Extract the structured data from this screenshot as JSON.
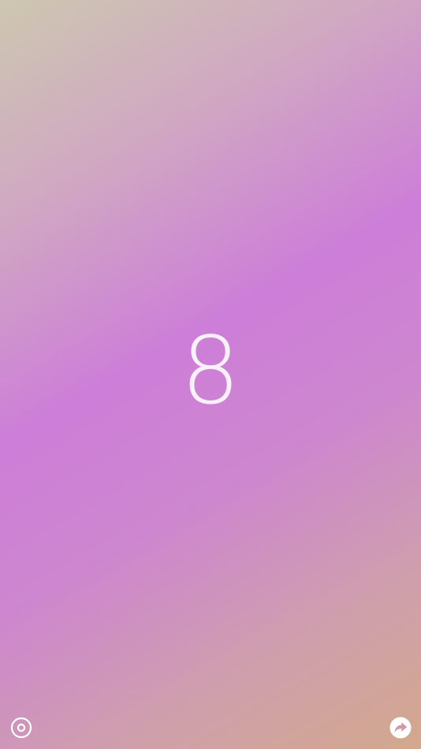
{
  "counter": {
    "value": "8"
  },
  "icons": {
    "settings": "settings-ring-icon",
    "share": "share-arrow-icon"
  },
  "colors": {
    "gradient_top_left": "#cdc7b0",
    "gradient_middle": "#cd7ed8",
    "gradient_bottom_right": "#d3a88d",
    "foreground": "#f8f1f8"
  }
}
